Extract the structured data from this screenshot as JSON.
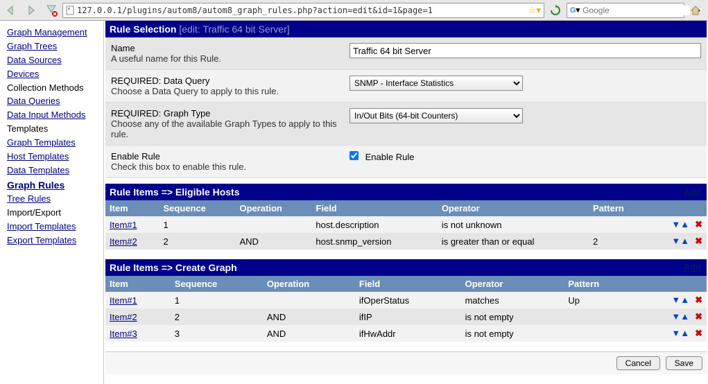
{
  "browser": {
    "url": "127.0.0.1/plugins/autom8/autom8_graph_rules.php?action=edit&id=1&page=1",
    "search_placeholder": "Google"
  },
  "sidebar": {
    "items": [
      {
        "label": "Graph Management",
        "link": true
      },
      {
        "label": "Graph Trees",
        "link": true
      },
      {
        "label": "Data Sources",
        "link": true
      },
      {
        "label": "Devices",
        "link": true
      },
      {
        "label": "Collection Methods",
        "link": false
      },
      {
        "label": "Data Queries",
        "link": true
      },
      {
        "label": "Data Input Methods",
        "link": true
      },
      {
        "label": "Templates",
        "link": false
      },
      {
        "label": "Graph Templates",
        "link": true
      },
      {
        "label": "Host Templates",
        "link": true
      },
      {
        "label": "Data Templates",
        "link": true
      },
      {
        "label": "Graph Rules",
        "link": true,
        "active": true
      },
      {
        "label": "Tree Rules",
        "link": true
      },
      {
        "label": "Import/Export",
        "link": false
      },
      {
        "label": "Import Templates",
        "link": true
      },
      {
        "label": "Export Templates",
        "link": true
      }
    ]
  },
  "rule_selection": {
    "header": "Rule Selection",
    "header_sub": "[edit: Traffic 64 bit Server]",
    "name": {
      "title": "Name",
      "desc": "A useful name for this Rule.",
      "value": "Traffic 64 bit Server"
    },
    "data_query": {
      "title": "REQUIRED: Data Query",
      "desc": "Choose a Data Query to apply to this rule.",
      "value": "SNMP - Interface Statistics"
    },
    "graph_type": {
      "title": "REQUIRED: Graph Type",
      "desc": "Choose any of the available Graph Types to apply to this rule.",
      "value": "In/Out Bits (64-bit Counters)"
    },
    "enable": {
      "title": "Enable Rule",
      "desc": "Check this box to enable this rule.",
      "label": "Enable Rule",
      "checked": true
    }
  },
  "eligible": {
    "header": "Rule Items => Eligible Hosts",
    "add": "Add",
    "cols": {
      "item": "Item",
      "seq": "Sequence",
      "op": "Operation",
      "field": "Field",
      "oper": "Operator",
      "pattern": "Pattern"
    },
    "rows": [
      {
        "item": "Item#1",
        "seq": "1",
        "op": "",
        "field": "host.description",
        "oper": "is not unknown",
        "pattern": ""
      },
      {
        "item": "Item#2",
        "seq": "2",
        "op": "AND",
        "field": "host.snmp_version",
        "oper": "is greater than or equal",
        "pattern": "2"
      }
    ]
  },
  "create": {
    "header": "Rule Items => Create Graph",
    "add": "Add",
    "cols": {
      "item": "Item",
      "seq": "Sequence",
      "op": "Operation",
      "field": "Field",
      "oper": "Operator",
      "pattern": "Pattern"
    },
    "rows": [
      {
        "item": "Item#1",
        "seq": "1",
        "op": "",
        "field": "ifOperStatus",
        "oper": "matches",
        "pattern": "Up"
      },
      {
        "item": "Item#2",
        "seq": "2",
        "op": "AND",
        "field": "ifIP",
        "oper": "is not empty",
        "pattern": ""
      },
      {
        "item": "Item#3",
        "seq": "3",
        "op": "AND",
        "field": "ifHwAddr",
        "oper": "is not empty",
        "pattern": ""
      }
    ]
  },
  "buttons": {
    "cancel": "Cancel",
    "save": "Save"
  }
}
